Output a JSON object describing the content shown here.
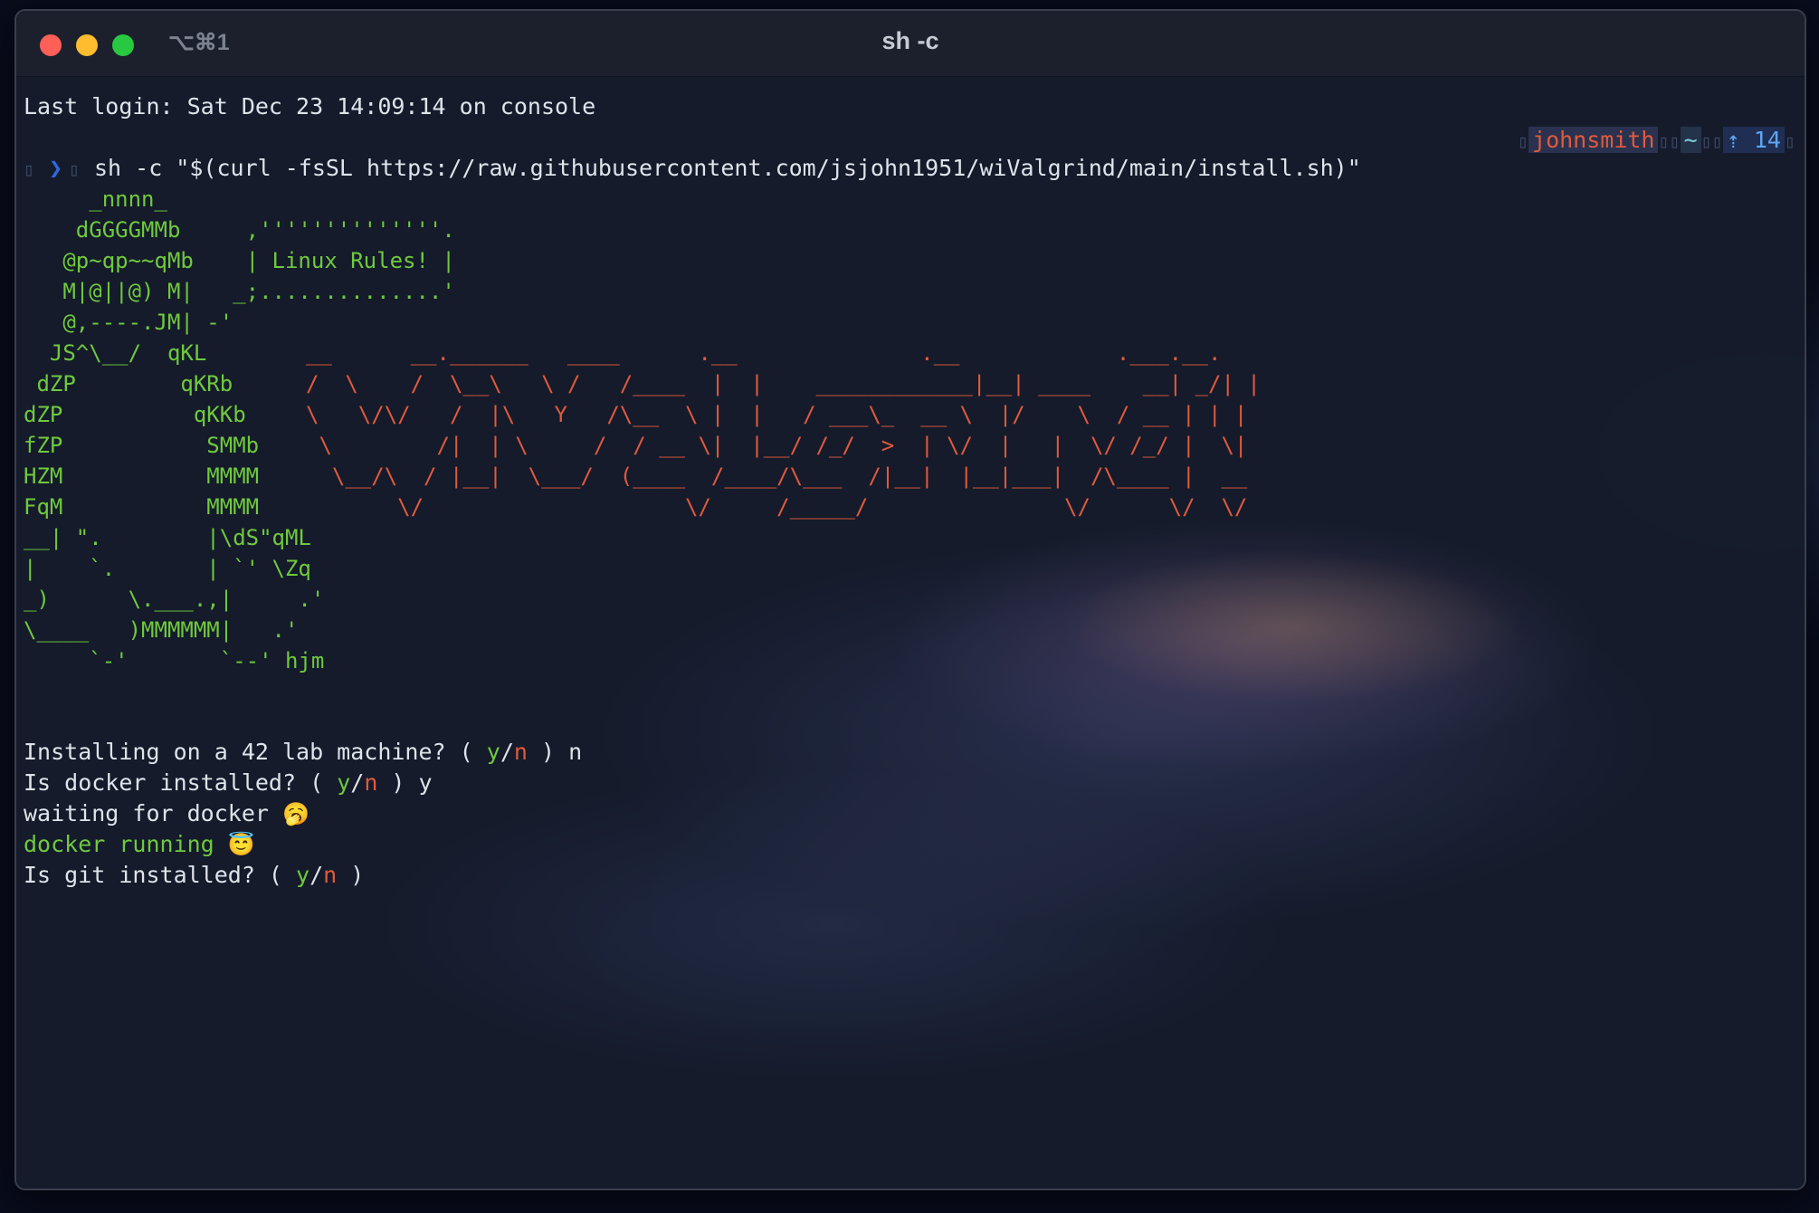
{
  "window": {
    "tab_shortcut": "⌥⌘1",
    "title": "sh -c"
  },
  "terminal": {
    "last_login": "Last login: Sat Dec 23 14:09:14 on console",
    "prompt_symbol": "❯",
    "command": "sh -c \"$(curl -fsSL https://raw.githubusercontent.com/jsjohn1951/wiValgrind/main/install.sh)\"",
    "status": {
      "user": "johnsmith",
      "cwd": "~",
      "git_ahead": "⇡ 14"
    },
    "tux_art": "     _nnnn_\n    dGGGGMMb     ,''''''''''''''.\n   @p~qp~~qMb    | Linux Rules! |\n   M|@||@) M|   _;..............'\n   @,----.JM| -'\n  JS^\\__/  qKL\n dZP        qKRb\ndZP          qKKb\nfZP           SMMb\nHZM           MMMM\nFqM           MMMM\n__| \".        |\\dS\"qML\n|    `.       | `' \\Zq\n_)      \\.___.,|     .'\n\\____   )MMMMMM|   .'\n     `-'       `--' hjm",
    "banner_art": "__      __.______   ____      .__              .__            .___.__.\n/  \\    /  \\__\\   \\ /   /____  |  |    ____________|__| ____    __| _/| |\n\\   \\/\\/   /  |\\   Y   /\\__  \\ |  |   / ___\\_  __ \\  |/    \\  / __ | | |\n \\        /|  | \\     /  / __ \\|  |__/ /_/  >  | \\/  |   |  \\/ /_/ |  \\|\n  \\__/\\  / |__|  \\___/  (____  /____/\\___  /|__|  |__|___|  /\\____ |  __\n       \\/                    \\/     /_____/               \\/      \\/  \\/",
    "q_lab": "Installing on a 42 lab machine? ( ",
    "q_lab_answer": " ) n",
    "q_docker": "Is docker installed? ( ",
    "q_docker_answer": " ) y",
    "opt_yes": "y",
    "opt_sep": "/",
    "opt_no": "n",
    "waiting_docker": "waiting for docker ",
    "waiting_emoji": "🥱",
    "docker_running": "docker running ",
    "running_emoji": "😇",
    "q_git": "Is git installed? ( ",
    "q_git_end": " )"
  },
  "colors": {
    "accent_green": "#6fc93d",
    "accent_red": "#e05a3c",
    "prompt_blue": "#2d6ae0"
  }
}
